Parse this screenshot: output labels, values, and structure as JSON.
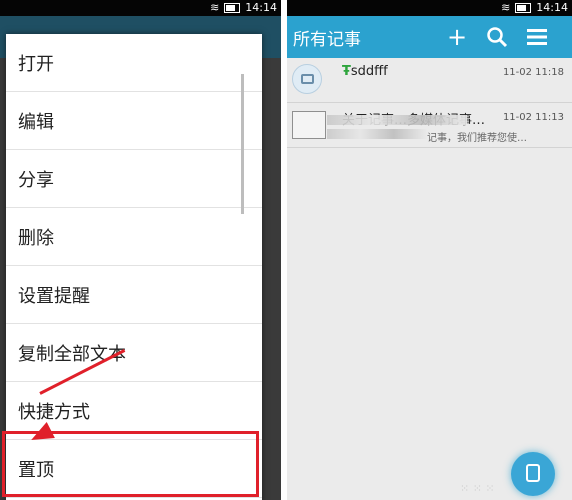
{
  "left": {
    "status_time": "14:14",
    "menu_items": [
      "打开",
      "编辑",
      "分享",
      "删除",
      "设置提醒",
      "复制全部文本",
      "快捷方式",
      "置顶"
    ]
  },
  "right": {
    "status_time": "14:14",
    "title": "所有记事",
    "notes": [
      {
        "pin": "Ŧ",
        "title": "sddfff",
        "time": "11-02 11:18"
      },
      {
        "title": "关于记事…多媒体记事…",
        "time": "11-02 11:13",
        "snippet": "记事，我们推荐您使…"
      }
    ]
  },
  "colors": {
    "accent": "#2ba2cf",
    "highlight": "#e0202a"
  },
  "icons": [
    "battery-icon",
    "wifi-icon",
    "add-icon",
    "search-icon",
    "menu-icon",
    "note-icon",
    "image-icon",
    "new-note-icon"
  ]
}
